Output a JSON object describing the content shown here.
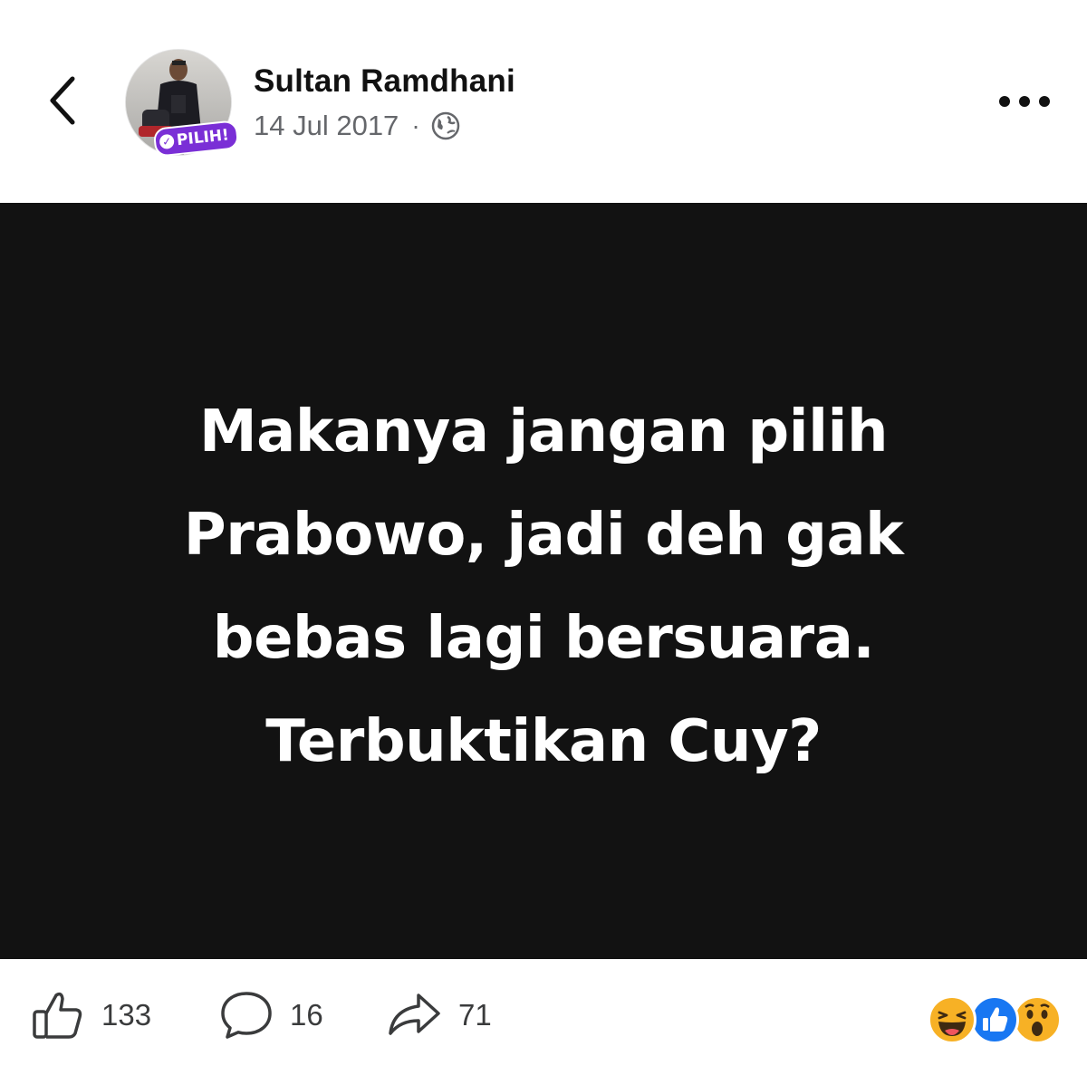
{
  "header": {
    "back_icon": "chevron-left-icon",
    "author_name": "Sultan Ramdhani",
    "avatar_badge": "PILIH!",
    "date": "14 Jul 2017",
    "separator": "·",
    "privacy_icon": "globe-icon",
    "more_icon": "more-horizontal-icon"
  },
  "post": {
    "lines": [
      "Makanya jangan pilih",
      "Prabowo, jadi deh gak",
      "bebas lagi bersuara.",
      "Terbuktikan Cuy?"
    ],
    "background_color": "#121212",
    "text_color": "#ffffff"
  },
  "footer": {
    "like": {
      "icon": "thumbs-up-icon",
      "count": "133"
    },
    "comment": {
      "icon": "comment-bubble-icon",
      "count": "16"
    },
    "share": {
      "icon": "share-arrow-icon",
      "count": "71"
    },
    "reactions": [
      "haha-reaction-icon",
      "like-reaction-icon",
      "wow-reaction-icon"
    ],
    "colors": {
      "like_blue": "#1877f2",
      "reaction_yellow": "#f7b125"
    }
  }
}
